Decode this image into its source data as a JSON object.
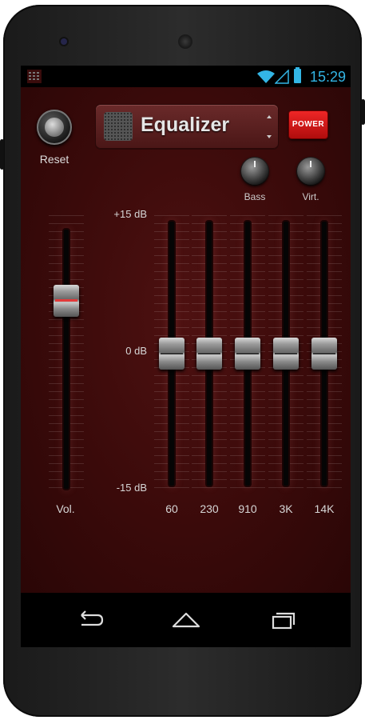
{
  "status_bar": {
    "time": "15:29",
    "icons": [
      "app-notification-icon",
      "wifi-icon",
      "signal-icon",
      "battery-icon"
    ],
    "accent_color": "#33b5e5"
  },
  "equalizer": {
    "title": "Equalizer",
    "reset_label": "Reset",
    "power_label": "POWER",
    "knobs": {
      "bass_label": "Bass",
      "virt_label": "Virt."
    },
    "scale": {
      "top": "+15 dB",
      "middle": "0 dB",
      "bottom": "-15 dB"
    },
    "volume": {
      "label": "Vol.",
      "level": 0.7
    },
    "bands": [
      {
        "label": "60",
        "db": 0
      },
      {
        "label": "230",
        "db": 0
      },
      {
        "label": "910",
        "db": 0
      },
      {
        "label": "3K",
        "db": 0
      },
      {
        "label": "14K",
        "db": 0
      }
    ],
    "colors": {
      "background": "#3a0a0a",
      "power_button": "#d41818"
    }
  },
  "navigation": {
    "buttons": [
      "back-icon",
      "home-icon",
      "recent-apps-icon"
    ]
  }
}
